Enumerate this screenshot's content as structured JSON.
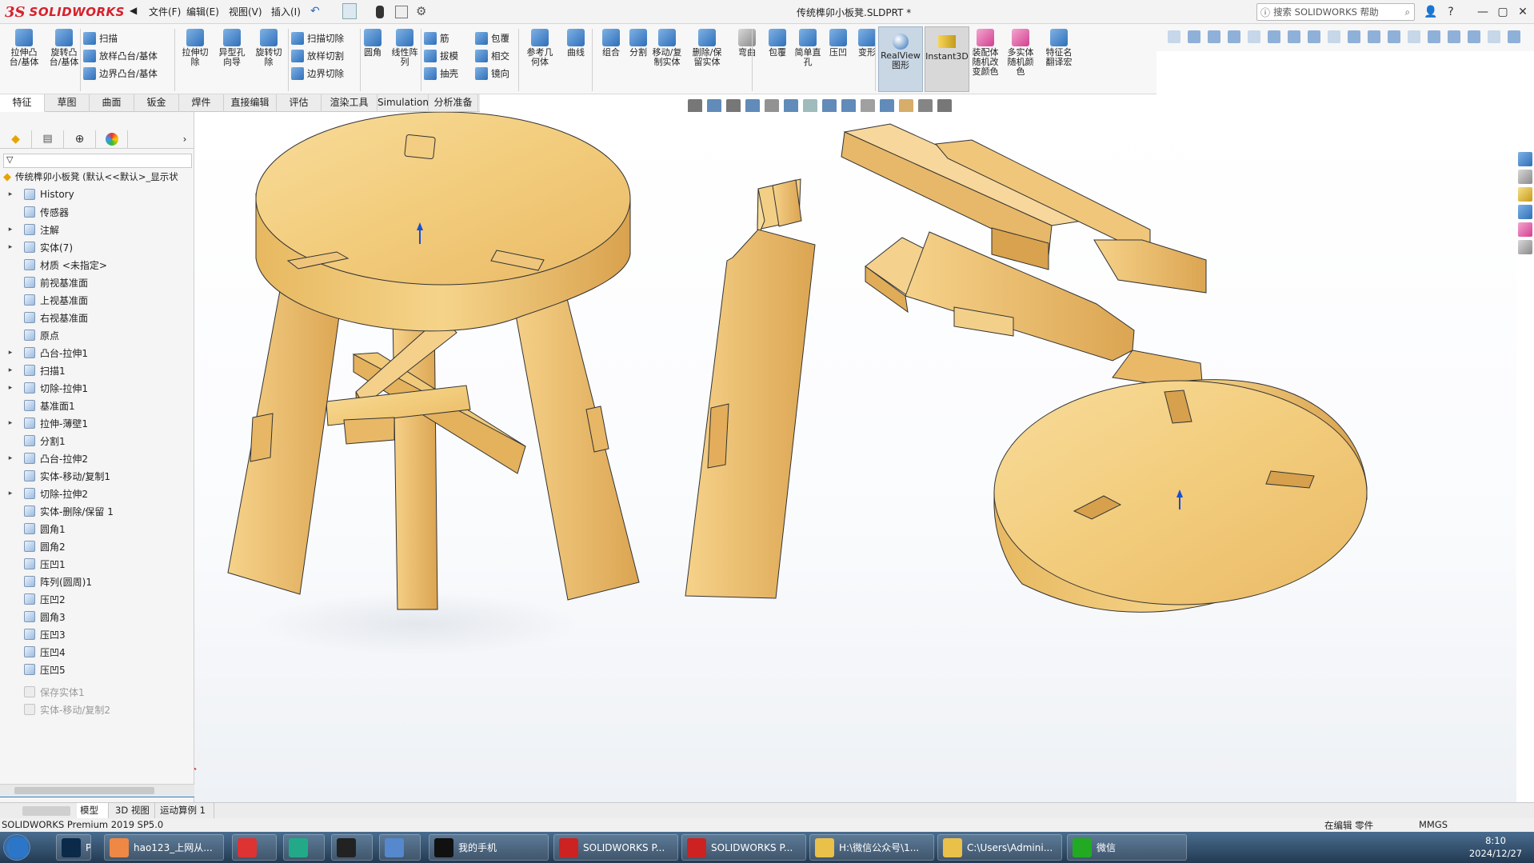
{
  "app": {
    "logo_ds": "3S",
    "logo_text": "SOLIDWORKS"
  },
  "menu": [
    "文件(F)",
    "编辑(E)",
    "视图(V)",
    "插入(I)"
  ],
  "document_title": "传统榫卯小板凳.SLDPRT *",
  "search": {
    "placeholder": "搜索 SOLIDWORKS 帮助"
  },
  "window_controls": [
    "?",
    "—",
    "▢",
    "✕"
  ],
  "command_manager": {
    "big": [
      {
        "label": "拉伸凸\n台/基体",
        "icon": "extrude-boss-icon",
        "color": "ic-blue"
      },
      {
        "label": "旋转凸\n台/基体",
        "icon": "revolve-boss-icon",
        "color": "ic-blue"
      },
      {
        "label": "拉伸切\n除",
        "icon": "extrude-cut-icon",
        "color": "ic-blue"
      },
      {
        "label": "异型孔\n向导",
        "icon": "hole-wizard-icon",
        "color": "ic-blue"
      },
      {
        "label": "旋转切\n除",
        "icon": "revolve-cut-icon",
        "color": "ic-blue"
      },
      {
        "label": "圆角",
        "icon": "fillet-icon",
        "color": "ic-blue"
      },
      {
        "label": "线性阵\n列",
        "icon": "linear-pattern-icon",
        "color": "ic-blue"
      },
      {
        "label": "参考几\n何体",
        "icon": "reference-geometry-icon",
        "color": "ic-blue"
      },
      {
        "label": "曲线",
        "icon": "curves-icon",
        "color": "ic-blue"
      },
      {
        "label": "组合",
        "icon": "combine-icon",
        "color": "ic-blue"
      },
      {
        "label": "分割",
        "icon": "split-icon",
        "color": "ic-blue"
      },
      {
        "label": "移动/复\n制实体",
        "icon": "move-copy-body-icon",
        "color": "ic-blue"
      },
      {
        "label": "删除/保\n留实体",
        "icon": "delete-keep-body-icon",
        "color": "ic-blue"
      },
      {
        "label": "弯曲",
        "icon": "flex-icon",
        "color": "ic-gray"
      },
      {
        "label": "包覆",
        "icon": "wrap-icon",
        "color": "ic-blue"
      },
      {
        "label": "简单直\n孔",
        "icon": "simple-hole-icon",
        "color": "ic-blue"
      },
      {
        "label": "压凹",
        "icon": "indent-icon",
        "color": "ic-blue"
      },
      {
        "label": "变形",
        "icon": "deform-icon",
        "color": "ic-blue"
      },
      {
        "label": "装配体\n随机改\n变颜色",
        "icon": "assembly-color-icon",
        "color": "ic-pink"
      },
      {
        "label": "多实体\n随机颜\n色",
        "icon": "multibody-color-icon",
        "color": "ic-pink"
      },
      {
        "label": "特征名\n翻译宏",
        "icon": "feature-translate-icon",
        "color": "ic-blue"
      }
    ],
    "small": [
      {
        "label": "扫描",
        "icon": "sweep-icon"
      },
      {
        "label": "放样凸台/基体",
        "icon": "loft-boss-icon"
      },
      {
        "label": "边界凸台/基体",
        "icon": "boundary-boss-icon"
      },
      {
        "label": "扫描切除",
        "icon": "swept-cut-icon"
      },
      {
        "label": "放样切割",
        "icon": "lofted-cut-icon"
      },
      {
        "label": "边界切除",
        "icon": "boundary-cut-icon"
      },
      {
        "label": "筋",
        "icon": "rib-icon"
      },
      {
        "label": "拔模",
        "icon": "draft-icon"
      },
      {
        "label": "抽壳",
        "icon": "shell-icon"
      },
      {
        "label": "包覆",
        "icon": "wrap-icon"
      },
      {
        "label": "相交",
        "icon": "intersect-icon"
      },
      {
        "label": "镜向",
        "icon": "mirror-icon"
      }
    ],
    "realview": "RealView\n图形",
    "instant3d": "Instant3D"
  },
  "tabs": [
    "特征",
    "草图",
    "曲面",
    "钣金",
    "焊件",
    "直接编辑",
    "评估",
    "渲染工具",
    "Simulation",
    "分析准备"
  ],
  "feature_tree": {
    "root": "传统榫卯小板凳 (默认<<默认>_显示状",
    "items": [
      {
        "label": "History",
        "exp": "▸"
      },
      {
        "label": "传感器",
        "exp": ""
      },
      {
        "label": "注解",
        "exp": "▸"
      },
      {
        "label": "实体(7)",
        "exp": "▸"
      },
      {
        "label": "材质 <未指定>",
        "exp": ""
      },
      {
        "label": "前视基准面",
        "exp": ""
      },
      {
        "label": "上视基准面",
        "exp": ""
      },
      {
        "label": "右视基准面",
        "exp": ""
      },
      {
        "label": "原点",
        "exp": ""
      },
      {
        "label": "凸台-拉伸1",
        "exp": "▸"
      },
      {
        "label": "扫描1",
        "exp": "▸"
      },
      {
        "label": "切除-拉伸1",
        "exp": "▸"
      },
      {
        "label": "基准面1",
        "exp": ""
      },
      {
        "label": "拉伸-薄壁1",
        "exp": "▸"
      },
      {
        "label": "分割1",
        "exp": ""
      },
      {
        "label": "凸台-拉伸2",
        "exp": "▸"
      },
      {
        "label": "实体-移动/复制1",
        "exp": ""
      },
      {
        "label": "切除-拉伸2",
        "exp": "▸"
      },
      {
        "label": "实体-删除/保留 1",
        "exp": ""
      },
      {
        "label": "圆角1",
        "exp": ""
      },
      {
        "label": "圆角2",
        "exp": ""
      },
      {
        "label": "压凹1",
        "exp": ""
      },
      {
        "label": "阵列(圆周)1",
        "exp": ""
      },
      {
        "label": "压凹2",
        "exp": ""
      },
      {
        "label": "圆角3",
        "exp": ""
      },
      {
        "label": "压凹3",
        "exp": ""
      },
      {
        "label": "压凹4",
        "exp": ""
      },
      {
        "label": "压凹5",
        "exp": ""
      }
    ],
    "suppressed": [
      "保存实体1",
      "实体-移动/复制2"
    ]
  },
  "bottom_tabs": [
    "模型",
    "3D 视图",
    "运动算例 1"
  ],
  "status": {
    "left": "SOLIDWORKS Premium 2019 SP5.0",
    "editing": "在编辑 零件",
    "units": "MMGS"
  },
  "taskbar": [
    {
      "label": "",
      "icon": "start-icon"
    },
    {
      "label": "Ps",
      "icon": "photoshop-icon"
    },
    {
      "label": "hao123_上网从...",
      "icon": "browser-icon"
    },
    {
      "label": "",
      "icon": "app-icon"
    },
    {
      "label": "",
      "icon": "app2-icon"
    },
    {
      "label": "",
      "icon": "record-icon"
    },
    {
      "label": "",
      "icon": "tool-icon"
    },
    {
      "label": "我的手机",
      "icon": "qq-icon"
    },
    {
      "label": "SOLIDWORKS P...",
      "icon": "solidworks-icon"
    },
    {
      "label": "SOLIDWORKS P...",
      "icon": "solidworks-icon"
    },
    {
      "label": "H:\\微信公众号\\1...",
      "icon": "folder-icon"
    },
    {
      "label": "C:\\Users\\Admini...",
      "icon": "folder-icon"
    },
    {
      "label": "微信",
      "icon": "wechat-icon"
    }
  ],
  "clock": {
    "time": "8:10",
    "date": "2024/12/27"
  },
  "colors": {
    "wood_light": "#f6d68f",
    "wood_dark": "#d9a552",
    "accent": "#2f7fd0"
  }
}
